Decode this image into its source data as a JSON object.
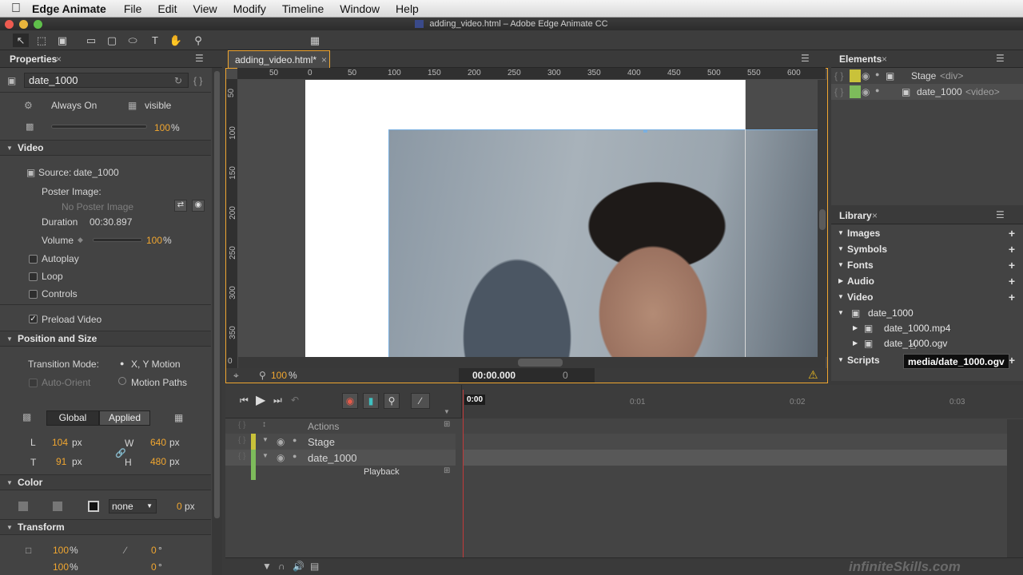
{
  "menubar": {
    "app_name": "Edge Animate",
    "items": [
      "File",
      "Edit",
      "View",
      "Modify",
      "Timeline",
      "Window",
      "Help"
    ]
  },
  "window": {
    "title": "adding_video.html – Adobe Edge Animate CC"
  },
  "properties": {
    "tab_label": "Properties",
    "element_id": "date_1000",
    "always_on": "Always On",
    "visible": "visible",
    "opacity": "100",
    "opacity_unit": "%",
    "video_section": "Video",
    "source_label": "Source:",
    "source_value": "date_1000",
    "poster_label": "Poster Image:",
    "poster_value": "No Poster Image",
    "duration_label": "Duration",
    "duration_value": "00:30.897",
    "volume_label": "Volume",
    "volume_value": "100",
    "volume_unit": "%",
    "autoplay": "Autoplay",
    "loop": "Loop",
    "controls": "Controls",
    "preload": "Preload Video",
    "position_section": "Position and Size",
    "transition_label": "Transition Mode:",
    "xy_motion": "X, Y Motion",
    "auto_orient": "Auto-Orient",
    "motion_paths": "Motion Paths",
    "global_btn": "Global",
    "applied_btn": "Applied",
    "l_label": "L",
    "l_value": "104",
    "t_label": "T",
    "t_value": "91",
    "w_label": "W",
    "w_value": "640",
    "h_label": "H",
    "h_value": "480",
    "px": "px",
    "color_section": "Color",
    "border_style": "none",
    "border_width": "0",
    "transform_section": "Transform",
    "scale_x": "100",
    "scale_y": "100",
    "pct": "%",
    "skew_x": "0",
    "skew_y": "0",
    "deg": "°"
  },
  "document": {
    "tab_label": "adding_video.html*",
    "ruler_top": [
      "50",
      "0",
      "50",
      "100",
      "150",
      "200",
      "250",
      "300",
      "350",
      "400",
      "450",
      "500",
      "550",
      "600"
    ],
    "ruler_left": [
      "50",
      "100",
      "150",
      "200",
      "250",
      "300",
      "350",
      "0"
    ],
    "zoom": "100",
    "zoom_unit": "%",
    "timecode": "00:00.000",
    "frame": "0"
  },
  "elements": {
    "tab_label": "Elements",
    "stage_label": "Stage",
    "stage_tag": "<div>",
    "video_label": "date_1000",
    "video_tag": "<video>"
  },
  "library": {
    "tab_label": "Library",
    "sections": [
      "Images",
      "Symbols",
      "Fonts",
      "Audio",
      "Video"
    ],
    "video_group": "date_1000",
    "file_mp4": "date_1000.mp4",
    "file_ogv": "date_1000.ogv",
    "scripts": "Scripts",
    "tooltip": "media/date_1000.ogv"
  },
  "timeline": {
    "actions": "Actions",
    "stage": "Stage",
    "video": "date_1000",
    "playback": "Playback",
    "playhead": "0:00",
    "marks": [
      "0:01",
      "0:02",
      "0:03"
    ]
  },
  "watermark": "infiniteSkills.com",
  "colors": {
    "accent": "#f0a630",
    "stage_bar": "#c9c23a",
    "video_bar": "#7dbb5b",
    "playhead": "#c23a3a"
  }
}
